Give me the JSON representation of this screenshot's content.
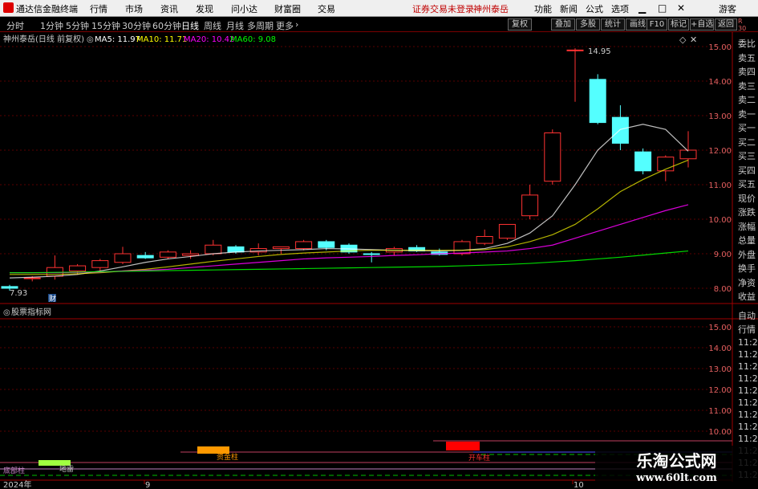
{
  "menubar": {
    "app_title": "通达信金融终端",
    "items": [
      "行情",
      "市场",
      "资讯",
      "发现",
      "问小达",
      "财富圈",
      "交易"
    ],
    "notice": "证券交易未登录",
    "stock": "神州泰岳",
    "right_items": [
      "功能",
      "新闻",
      "公式",
      "选项"
    ],
    "guest": "游客"
  },
  "periods": {
    "items": [
      "分时",
      "1分钟",
      "5分钟",
      "15分钟",
      "30分钟",
      "60分钟",
      "日线",
      "周线",
      "月线",
      "多周期",
      "更多"
    ],
    "selected": "日线"
  },
  "toolbar": [
    "复权",
    "叠加",
    "多股",
    "统计",
    "画线",
    "F10",
    "标记",
    "+自选",
    "返回"
  ],
  "main_legend": {
    "title": "神州泰岳(日线 前复权)",
    "ma5": "MA5: 11.97",
    "ma10": "MA10: 11.71",
    "ma20": "MA20: 10.42",
    "ma60": "MA60: 9.08",
    "colors": {
      "ma5": "#ffffff",
      "ma10": "#ffff00",
      "ma20": "#ff00ff",
      "ma60": "#00ff00"
    }
  },
  "main_axis": [
    "15.00",
    "14.00",
    "13.00",
    "12.00",
    "11.00",
    "10.00",
    "9.00",
    "8.00"
  ],
  "annotations": {
    "high": "14.95",
    "low": "7.93",
    "marker": "财"
  },
  "right_panel": [
    "委比",
    "卖五",
    "卖四",
    "卖三",
    "卖二",
    "卖一",
    "买一",
    "买二",
    "买三",
    "买四",
    "买五",
    "现价",
    "涨跌",
    "涨幅",
    "总量",
    "外盘",
    "换手",
    "净资",
    "收益"
  ],
  "right_panel_lower": [
    "自动",
    "行情"
  ],
  "right_panel_times": [
    "11:2",
    "11:2",
    "11:2",
    "11:2",
    "11:2",
    "11:2",
    "11:2",
    "11:2",
    "11:2",
    "11:2",
    "11:2",
    "11:2"
  ],
  "sub_panel": {
    "title": "股票指标网",
    "axis": [
      "15.00",
      "14.00",
      "13.00",
      "12.00",
      "11.00",
      "10.00"
    ],
    "labels": [
      "资金柱",
      "开车柱",
      "底部柱",
      "地雷"
    ]
  },
  "bottom_axis": {
    "year": "2024年",
    "m1": "9",
    "m2": "10"
  },
  "watermark": {
    "title": "乐淘公式网",
    "url": "www.60lt.com"
  },
  "chart_data": {
    "type": "candlestick",
    "title": "神州泰岳(日线 前复权)",
    "ylim": [
      7.6,
      15.3
    ],
    "candles": [
      {
        "o": 8.05,
        "h": 8.1,
        "l": 7.93,
        "c": 8.0
      },
      {
        "o": 8.3,
        "h": 8.35,
        "l": 8.2,
        "c": 8.3
      },
      {
        "o": 8.35,
        "h": 8.95,
        "l": 8.25,
        "c": 8.6
      },
      {
        "o": 8.5,
        "h": 8.7,
        "l": 8.4,
        "c": 8.65
      },
      {
        "o": 8.6,
        "h": 8.85,
        "l": 8.5,
        "c": 8.8
      },
      {
        "o": 8.75,
        "h": 9.2,
        "l": 8.7,
        "c": 9.0
      },
      {
        "o": 8.95,
        "h": 9.05,
        "l": 8.85,
        "c": 8.88
      },
      {
        "o": 8.9,
        "h": 9.1,
        "l": 8.85,
        "c": 9.05
      },
      {
        "o": 8.95,
        "h": 9.1,
        "l": 8.85,
        "c": 9.0
      },
      {
        "o": 9.0,
        "h": 9.4,
        "l": 8.95,
        "c": 9.25
      },
      {
        "o": 9.2,
        "h": 9.25,
        "l": 9.0,
        "c": 9.05
      },
      {
        "o": 9.05,
        "h": 9.3,
        "l": 8.95,
        "c": 9.15
      },
      {
        "o": 9.15,
        "h": 9.2,
        "l": 9.0,
        "c": 9.2
      },
      {
        "o": 9.15,
        "h": 9.4,
        "l": 9.1,
        "c": 9.35
      },
      {
        "o": 9.35,
        "h": 9.4,
        "l": 9.1,
        "c": 9.18
      },
      {
        "o": 9.25,
        "h": 9.3,
        "l": 9.0,
        "c": 9.05
      },
      {
        "o": 9.0,
        "h": 9.05,
        "l": 8.75,
        "c": 8.98
      },
      {
        "o": 9.05,
        "h": 9.2,
        "l": 8.95,
        "c": 9.15
      },
      {
        "o": 9.18,
        "h": 9.25,
        "l": 9.05,
        "c": 9.08
      },
      {
        "o": 9.05,
        "h": 9.15,
        "l": 8.95,
        "c": 8.98
      },
      {
        "o": 9.0,
        "h": 9.4,
        "l": 8.95,
        "c": 9.35
      },
      {
        "o": 9.3,
        "h": 9.7,
        "l": 9.25,
        "c": 9.5
      },
      {
        "o": 9.45,
        "h": 9.85,
        "l": 9.4,
        "c": 9.85
      },
      {
        "o": 10.1,
        "h": 11.0,
        "l": 10.0,
        "c": 10.7
      },
      {
        "o": 11.1,
        "h": 12.6,
        "l": 11.0,
        "c": 12.5
      },
      {
        "o": 14.9,
        "h": 14.95,
        "l": 13.4,
        "c": 14.9
      },
      {
        "o": 14.05,
        "h": 14.2,
        "l": 12.75,
        "c": 12.8
      },
      {
        "o": 12.95,
        "h": 13.3,
        "l": 12.0,
        "c": 12.2
      },
      {
        "o": 11.95,
        "h": 12.05,
        "l": 11.3,
        "c": 11.4
      },
      {
        "o": 11.4,
        "h": 11.85,
        "l": 11.1,
        "c": 11.8
      },
      {
        "o": 11.75,
        "h": 12.55,
        "l": 11.5,
        "c": 12.0
      }
    ],
    "series": [
      {
        "name": "MA5",
        "values": [
          8.3,
          8.32,
          8.35,
          8.4,
          8.5,
          8.62,
          8.75,
          8.85,
          8.92,
          9.0,
          9.05,
          9.08,
          9.1,
          9.12,
          9.15,
          9.14,
          9.12,
          9.1,
          9.09,
          9.08,
          9.1,
          9.15,
          9.3,
          9.6,
          10.1,
          11.0,
          12.0,
          12.6,
          12.75,
          12.6,
          11.97
        ]
      },
      {
        "name": "MA10",
        "values": [
          8.4,
          8.4,
          8.4,
          8.42,
          8.45,
          8.5,
          8.55,
          8.62,
          8.7,
          8.78,
          8.85,
          8.92,
          8.98,
          9.02,
          9.05,
          9.08,
          9.1,
          9.1,
          9.1,
          9.1,
          9.1,
          9.12,
          9.2,
          9.35,
          9.55,
          9.85,
          10.3,
          10.8,
          11.15,
          11.45,
          11.71
        ]
      },
      {
        "name": "MA20",
        "values": [
          8.45,
          8.45,
          8.45,
          8.46,
          8.47,
          8.5,
          8.52,
          8.55,
          8.6,
          8.65,
          8.7,
          8.75,
          8.8,
          8.85,
          8.88,
          8.9,
          8.92,
          8.95,
          8.97,
          9.0,
          9.02,
          9.05,
          9.08,
          9.15,
          9.25,
          9.45,
          9.65,
          9.85,
          10.05,
          10.25,
          10.42
        ]
      },
      {
        "name": "MA60",
        "values": [
          8.45,
          8.45,
          8.46,
          8.47,
          8.48,
          8.49,
          8.5,
          8.51,
          8.52,
          8.53,
          8.54,
          8.55,
          8.56,
          8.57,
          8.58,
          8.59,
          8.6,
          8.61,
          8.62,
          8.63,
          8.65,
          8.67,
          8.69,
          8.72,
          8.76,
          8.8,
          8.85,
          8.9,
          8.96,
          9.02,
          9.08
        ]
      }
    ]
  }
}
